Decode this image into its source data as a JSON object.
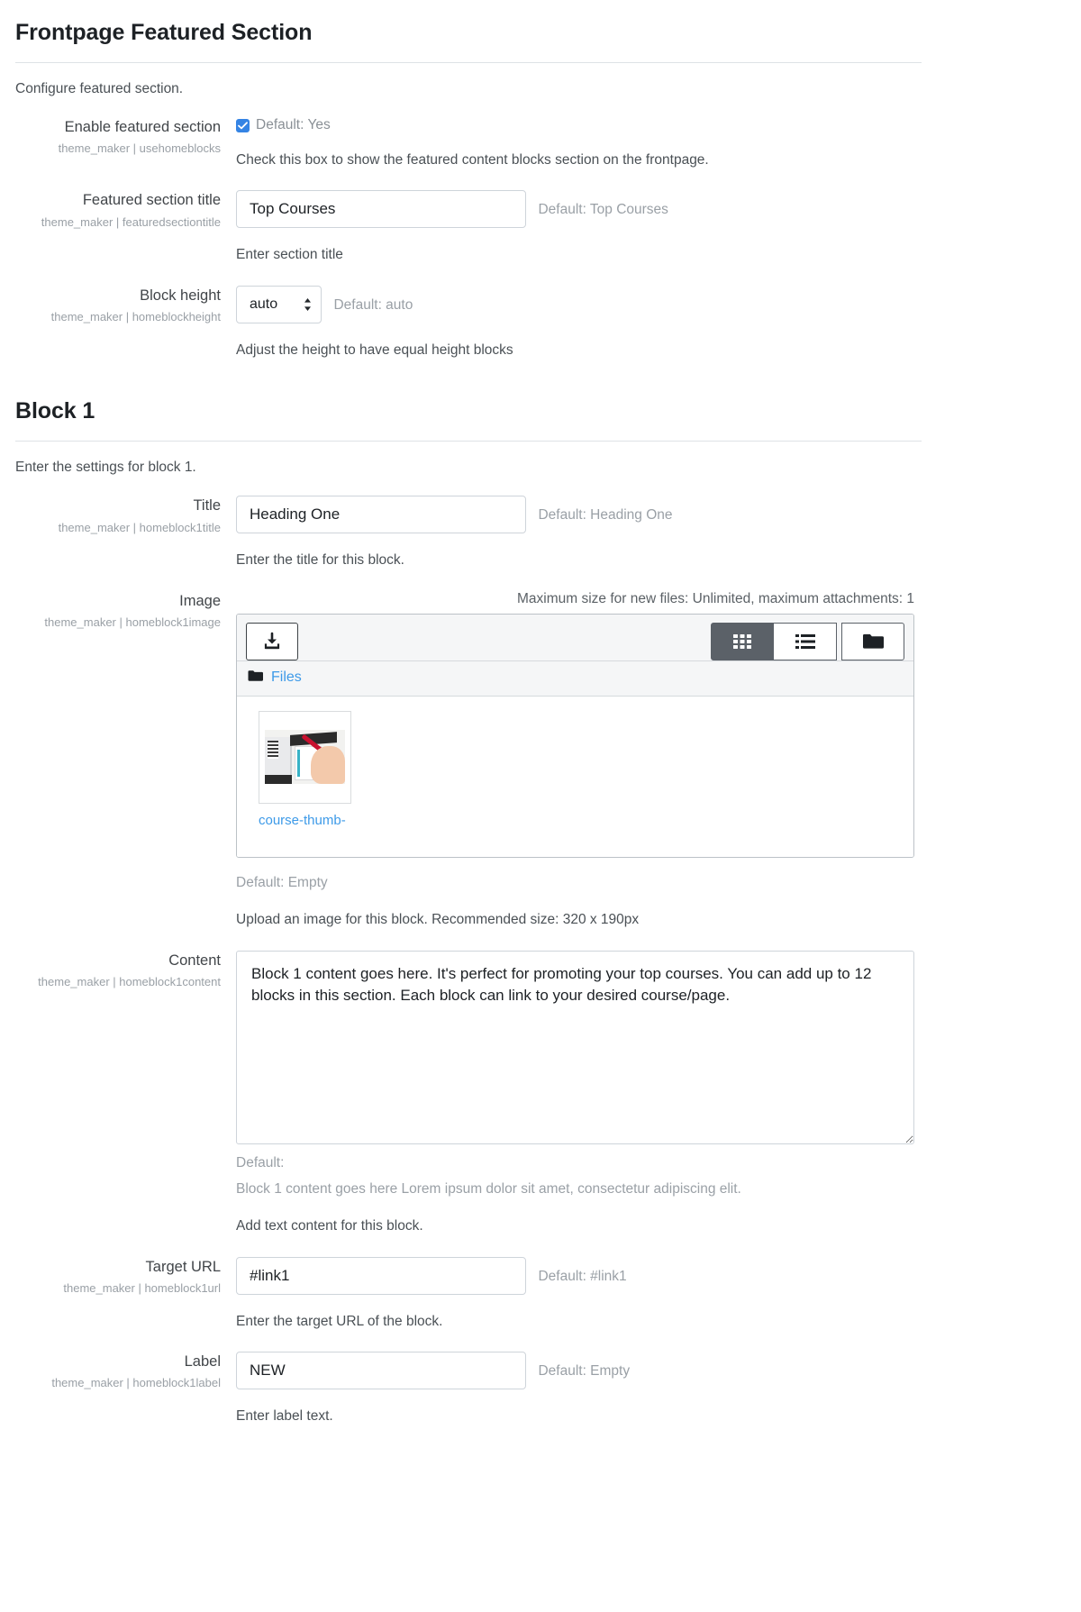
{
  "sections": [
    {
      "heading": "Frontpage Featured Section",
      "description": "Configure featured section."
    },
    {
      "heading": "Block 1",
      "description": "Enter the settings for block 1."
    }
  ],
  "fields": {
    "enable_featured": {
      "label": "Enable featured section",
      "setting": "theme_maker | usehomeblocks",
      "checkbox_label": "Default: Yes",
      "checked": true,
      "help": "Check this box to show the featured content blocks section on the frontpage."
    },
    "featured_title": {
      "label": "Featured section title",
      "setting": "theme_maker | featuredsectiontitle",
      "value": "Top Courses",
      "default": "Default: Top Courses",
      "help": "Enter section title"
    },
    "block_height": {
      "label": "Block height",
      "setting": "theme_maker | homeblockheight",
      "value": "auto",
      "options": [
        "auto"
      ],
      "default": "Default: auto",
      "help": "Adjust the height to have equal height blocks"
    },
    "block1_title": {
      "label": "Title",
      "setting": "theme_maker | homeblock1title",
      "value": "Heading One",
      "default": "Default: Heading One",
      "help": "Enter the title for this block."
    },
    "block1_image": {
      "label": "Image",
      "setting": "theme_maker | homeblock1image",
      "max_size_note": "Maximum size for new files: Unlimited, maximum attachments: 1",
      "breadcrumb": "Files",
      "file_name": "course-thumb-",
      "default": "Default: Empty",
      "help": "Upload an image for this block. Recommended size: 320 x 190px"
    },
    "block1_content": {
      "label": "Content",
      "setting": "theme_maker | homeblock1content",
      "value": "Block 1 content goes here. It's perfect for promoting your top courses. You can add up to 12 blocks in this section. Each block can link to your desired course/page.",
      "default_label": "Default:",
      "default_value": "Block 1 content goes here Lorem ipsum dolor sit amet, consectetur adipiscing elit.",
      "help": "Add text content for this block."
    },
    "block1_url": {
      "label": "Target URL",
      "setting": "theme_maker | homeblock1url",
      "value": "#link1",
      "default": "Default: #link1",
      "help": "Enter the target URL of the block."
    },
    "block1_label": {
      "label": "Label",
      "setting": "theme_maker | homeblock1label",
      "value": "NEW",
      "default": "Default: Empty",
      "help": "Enter label text."
    }
  },
  "filepicker_buttons": {
    "upload": "upload-icon",
    "grid_view": "grid-view-icon",
    "list_view": "list-view-icon",
    "tree_view": "folder-tree-icon",
    "active_view": "grid"
  },
  "colors": {
    "link": "#3d9ae8",
    "checkbox": "#3584e4",
    "active_button": "#5b6168",
    "muted_text": "#9aa0a6"
  }
}
